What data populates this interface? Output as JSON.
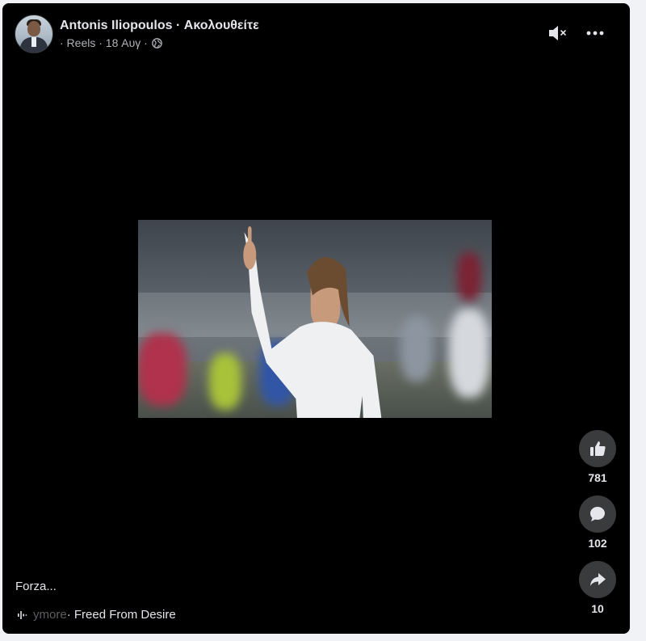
{
  "post": {
    "author": "Antonis Iliopoulos",
    "separator": " · ",
    "follow": "Ακολουθείτε",
    "meta_prefix": "· Reels · 18 Αυγ ·"
  },
  "icons": {
    "mute": "volume-muted-icon",
    "more": "more-horizontal-icon",
    "privacy": "globe-icon",
    "like": "thumbs-up-icon",
    "comment": "comment-icon",
    "share": "share-icon",
    "audio": "audio-wave-icon"
  },
  "actions": {
    "likes": "781",
    "comments": "102",
    "shares": "10"
  },
  "caption": "Forza...",
  "audio": {
    "faded": "ymore",
    "title": " · Freed From Desire"
  },
  "colors": {
    "background": "#000000",
    "page": "#f0f2f5",
    "text": "#e4e6eb",
    "secondary": "#b0b3b8",
    "button": "#3a3b3c"
  }
}
